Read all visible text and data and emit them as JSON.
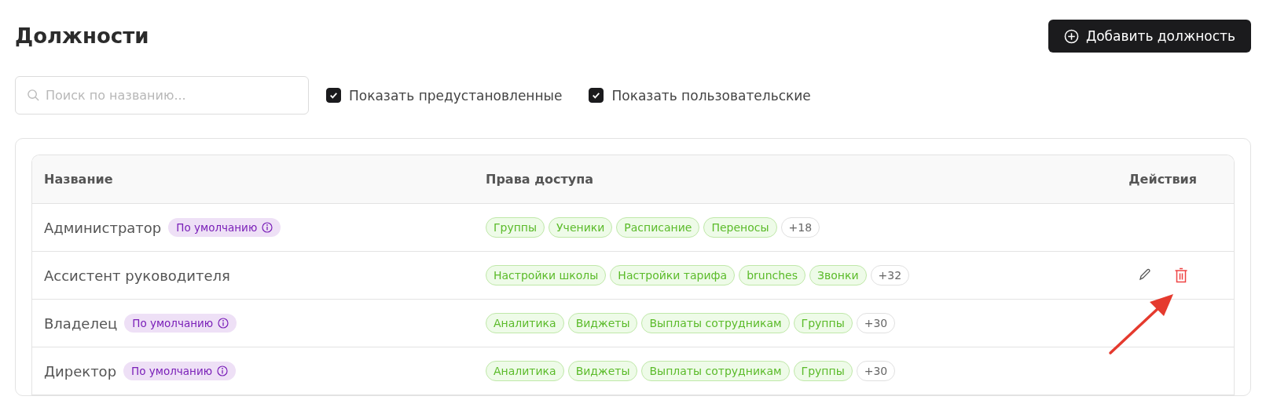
{
  "page": {
    "title": "Должности",
    "add_button": "Добавить должность"
  },
  "filters": {
    "search": {
      "placeholder": "Поиск по названию..."
    },
    "checkboxes": [
      {
        "label": "Показать предустановленные",
        "checked": true
      },
      {
        "label": "Показать пользовательские",
        "checked": true
      }
    ]
  },
  "table": {
    "columns": [
      "Название",
      "Права доступа",
      "Действия"
    ],
    "rows": [
      {
        "name": "Администратор",
        "badge": "По умолчанию",
        "permissions": [
          {
            "kind": "tag",
            "label": "Группы"
          },
          {
            "kind": "tag",
            "label": "Ученики"
          },
          {
            "kind": "tag",
            "label": "Расписание"
          },
          {
            "kind": "tag",
            "label": "Переносы"
          },
          {
            "kind": "more",
            "label": "+18"
          }
        ],
        "actions_visible": false
      },
      {
        "name": "Ассистент руководителя",
        "permissions": [
          {
            "kind": "tag",
            "label": "Настройки школы"
          },
          {
            "kind": "tag",
            "label": "Настройки тарифа"
          },
          {
            "kind": "tag",
            "label": "brunches"
          },
          {
            "kind": "tag",
            "label": "Звонки"
          },
          {
            "kind": "more",
            "label": "+32"
          }
        ],
        "actions_visible": true
      },
      {
        "name": "Владелец",
        "badge": "По умолчанию",
        "permissions": [
          {
            "kind": "tag",
            "label": "Аналитика"
          },
          {
            "kind": "tag",
            "label": "Виджеты"
          },
          {
            "kind": "tag",
            "label": "Выплаты сотрудникам"
          },
          {
            "kind": "tag",
            "label": "Группы"
          },
          {
            "kind": "more",
            "label": "+30"
          }
        ],
        "actions_visible": false
      },
      {
        "name": "Директор",
        "badge": "По умолчанию",
        "permissions": [
          {
            "kind": "tag",
            "label": "Аналитика"
          },
          {
            "kind": "tag",
            "label": "Виджеты"
          },
          {
            "kind": "tag",
            "label": "Выплаты сотрудникам"
          },
          {
            "kind": "tag",
            "label": "Группы"
          },
          {
            "kind": "more",
            "label": "+30"
          }
        ],
        "actions_visible": false
      }
    ]
  }
}
